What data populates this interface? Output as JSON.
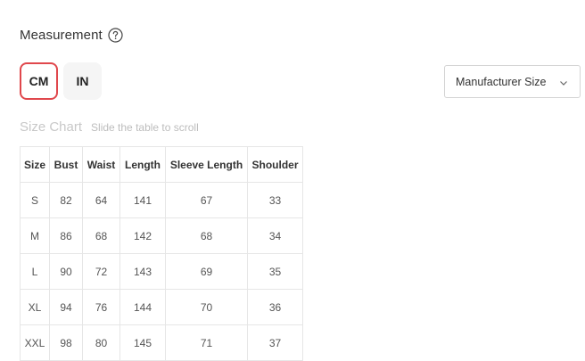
{
  "measurement": {
    "title": "Measurement",
    "help_icon": "question-circle-icon"
  },
  "units": {
    "cm": "CM",
    "in": "IN",
    "selected": "CM"
  },
  "size_select": {
    "value": "Manufacturer Size",
    "icon": "chevron-down-icon"
  },
  "size_chart": {
    "title": "Size Chart",
    "hint": "Slide the table to scroll",
    "headers": [
      "Size",
      "Bust",
      "Waist",
      "Length",
      "Sleeve Length",
      "Shoulder"
    ],
    "rows": [
      [
        "S",
        "82",
        "64",
        "141",
        "67",
        "33"
      ],
      [
        "M",
        "86",
        "68",
        "142",
        "68",
        "34"
      ],
      [
        "L",
        "90",
        "72",
        "143",
        "69",
        "35"
      ],
      [
        "XL",
        "94",
        "76",
        "144",
        "70",
        "36"
      ],
      [
        "XXL",
        "98",
        "80",
        "145",
        "71",
        "37"
      ]
    ]
  },
  "colors": {
    "accent": "#e0474c",
    "border": "#e6e6e6"
  }
}
